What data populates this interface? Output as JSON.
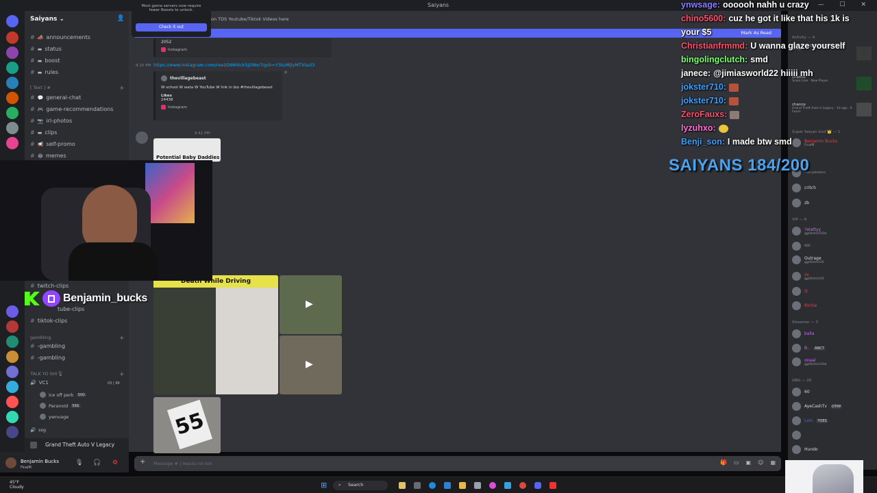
{
  "window": {
    "title": "Saiyans",
    "controls": "— ☐ ✕"
  },
  "server": {
    "name": "Saiyans",
    "dropdown": "⌄"
  },
  "channels": [
    {
      "emoji": "📣",
      "name": "announcements"
    },
    {
      "emoji": "▬",
      "name": "status"
    },
    {
      "emoji": "▬",
      "name": "boost"
    },
    {
      "emoji": "▬",
      "name": "rules"
    }
  ],
  "categories": {
    "text": "[ Text ] #",
    "gambling": "gambling",
    "talk": "TALK YO SHI🎙"
  },
  "text_channels": [
    {
      "emoji": "💬",
      "name": "general-chat"
    },
    {
      "emoji": "🎮",
      "name": "game-recommendations"
    },
    {
      "emoji": "📷",
      "name": "irl-photos"
    },
    {
      "emoji": "▬",
      "name": "clips"
    },
    {
      "emoji": "📢",
      "name": "self-promo"
    },
    {
      "emoji": "😂",
      "name": "memes"
    }
  ],
  "clip_channels": [
    {
      "name": "twitch-clips"
    },
    {
      "name": "tube-clips"
    },
    {
      "name": "tiktok-clips"
    }
  ],
  "gambling_channels": [
    {
      "name": "-gambling"
    },
    {
      "name": "-gambling"
    }
  ],
  "voice": {
    "channel": "VC1",
    "count": "03 | 99",
    "users": [
      {
        "name": "ice off perk",
        "badge": "SVG"
      },
      {
        "name": "Paranoid",
        "badge": "SSG"
      },
      {
        "name": "ywnvage",
        "badge": ""
      }
    ],
    "more": "ssg"
  },
  "activity": "Grand Theft Auto V Legacy",
  "user": {
    "name": "Benjamin Bucks",
    "status": "FinalM"
  },
  "boost_popup": {
    "text": "Most game servers now require fewer Boosts to unlock.",
    "button": "Check it out"
  },
  "top_notice": "on TDS Youtube/Tiktok Videos here",
  "mark_as_read": "Mark As Read",
  "messages": {
    "embed1": {
      "likes": "2052",
      "source": "Instagram"
    },
    "time1": "9:15 PM",
    "link": "https://www.instagram.com/reel/DWK6ck5jONo/?igsh=Y3kzMjlyMTViazl3",
    "embed2": {
      "author": "thevillagebeast",
      "text": "W school W wata W YouTube W link in bio #thevillagebeast",
      "likes_label": "Likes",
      "likes": "24438",
      "source": "Instagram"
    },
    "time2": "9:41 PM",
    "image_card_title": "Potential Baby Daddies",
    "image_card_header": "Death While Driving",
    "sign": "55"
  },
  "composer": {
    "placeholder": "Message # | reacts-no-tox"
  },
  "members": {
    "activity": {
      "label": "Activity — 4",
      "items": [
        {
          "title": "Tom Clancy's Rainbow Six ...",
          "sub": "3d ago"
        },
        {
          "title": "chance",
          "sub": "Scam Line · New Player"
        },
        {
          "title": "chance",
          "sub": "Grand Theft Auto V Legacy · 1d ago · 6 hours"
        }
      ]
    },
    "groups": [
      {
        "label": "Super Saiyan God 👑 — 1",
        "members": [
          {
            "name": "Benjamin Bucks",
            "status": "FinalM",
            "color": "#f23f43"
          }
        ]
      },
      {
        "label": "",
        "members": [
          {
            "name": "",
            "status": "free palestine",
            "color": "#b5bac1"
          },
          {
            "name": "critch",
            "status": "",
            "color": "#b5bac1"
          },
          {
            "name": "zb",
            "status": "",
            "color": "#b5bac1"
          }
        ]
      },
      {
        "label": "VIP — 6",
        "members": [
          {
            "name": "?alattyy",
            "status": "gg/district10al",
            "color": "#d067ff"
          },
          {
            "name": "",
            "status": "666",
            "color": "#b5bac1"
          },
          {
            "name": "Outrage",
            "status": "gg/district10",
            "color": "#b5bac1"
          },
          {
            "name": "zx",
            "status": "gg/district10",
            "color": "#f23f43"
          },
          {
            "name": "Q",
            "status": "",
            "color": "#f23f43"
          },
          {
            "name": "Richie",
            "status": "",
            "color": "#f23f43"
          }
        ]
      },
      {
        "label": "Streamer — 3",
        "members": [
          {
            "name": "balla",
            "status": "",
            "color": "#d067ff"
          },
          {
            "name": "B..",
            "status": "ANCT",
            "color": "#d067ff"
          },
          {
            "name": "oneal",
            "status": "gg/district10al",
            "color": "#d067ff"
          }
        ]
      },
      {
        "label": "GBG — 20",
        "members": [
          {
            "name": "60",
            "status": "",
            "color": "#b5bac1"
          },
          {
            "name": "AyeCashTv",
            "status": "OTRP",
            "color": "#b5bac1"
          },
          {
            "name": "Lxin",
            "status": "TOES",
            "color": "#5865f2"
          },
          {
            "name": "",
            "status": "",
            "color": "#b5bac1"
          },
          {
            "name": "Hundo",
            "status": "",
            "color": "#b5bac1"
          }
        ]
      }
    ]
  },
  "overlay": {
    "streamer": "Benjamin_bucks",
    "goal": "SAIYANS 184/200",
    "chat": [
      {
        "user": "ynwsage:",
        "color": "#8a7dff",
        "text": "oooooh nahh u crazy"
      },
      {
        "user": "chino5600:",
        "color": "#ff4d6d",
        "text": "cuz he got it like that his 1k is"
      },
      {
        "user": "",
        "color": "#ffffff",
        "text": "your $5"
      },
      {
        "user": "Christianfrmmd:",
        "color": "#ff4d6d",
        "text": "U wanna glaze yourself"
      },
      {
        "user": "bingolingclutch:",
        "color": "#7cff6b",
        "text": "smd"
      },
      {
        "user": "janece:",
        "color": "#ffffff",
        "text": "@jimiasworld22 hiiiii mh"
      },
      {
        "user": "jokster710:",
        "color": "#3aa0ff",
        "text": ""
      },
      {
        "user": "jokster710:",
        "color": "#3aa0ff",
        "text": ""
      },
      {
        "user": "ZeroFauxs:",
        "color": "#ff4d6d",
        "text": ""
      },
      {
        "user": "lyzuhxo:",
        "color": "#ff6fd8",
        "text": ""
      },
      {
        "user": "Benji_son:",
        "color": "#3aa0ff",
        "text": "I made btw smd"
      }
    ]
  },
  "taskbar": {
    "temp": "45°F",
    "weather": "Cloudy",
    "search": "Search"
  }
}
